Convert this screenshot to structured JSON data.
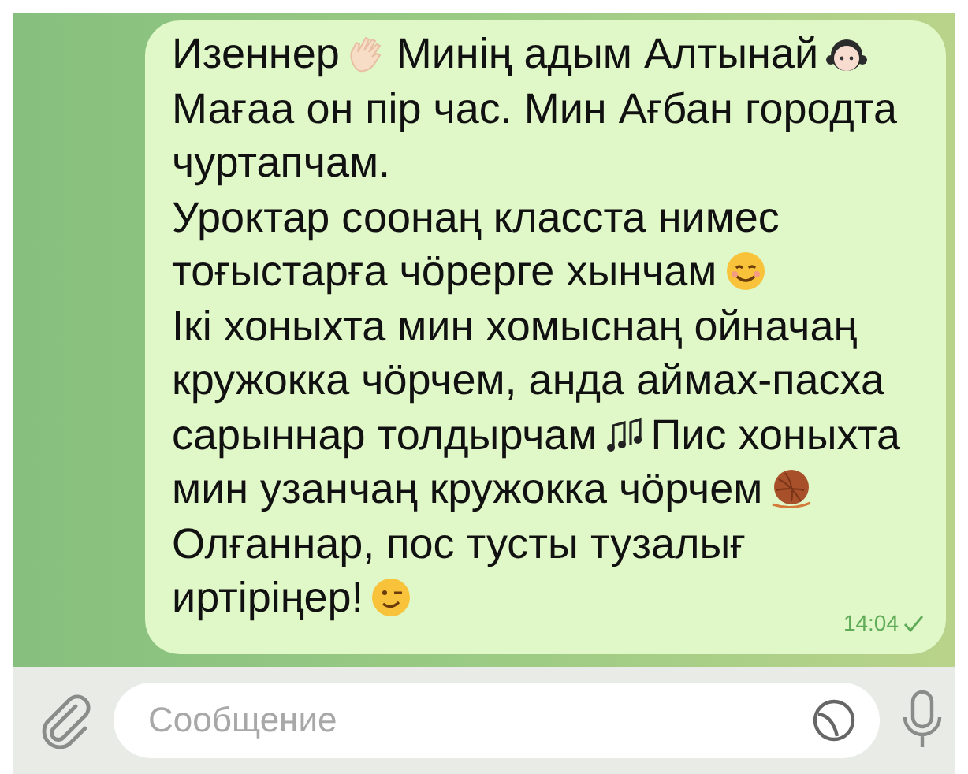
{
  "message": {
    "lines": [
      {
        "segments": [
          {
            "kind": "text",
            "text": "Изеннер"
          },
          {
            "kind": "emoji"
          },
          {
            "kind": "text",
            "text": "Минің адым Алтынай"
          },
          {
            "kind": "emoji"
          }
        ]
      },
      {
        "segments": [
          {
            "kind": "text",
            "text": "Мағаа он пір час. Мин Ағбан городта"
          }
        ]
      },
      {
        "segments": [
          {
            "kind": "text",
            "text": "чуртапчам."
          }
        ]
      },
      {
        "segments": [
          {
            "kind": "text",
            "text": "Уроктар соонаң класста нимес"
          }
        ]
      },
      {
        "segments": [
          {
            "kind": "text",
            "text": "тоғыстарға чӧрерге хынчам"
          },
          {
            "kind": "emoji"
          }
        ]
      },
      {
        "segments": [
          {
            "kind": "text",
            "text": "Ікі хоныхта мин хомыснаң ойначаң"
          }
        ]
      },
      {
        "segments": [
          {
            "kind": "text",
            "text": "кружокка чӧрчем, анда аймах-пасха"
          }
        ]
      },
      {
        "segments": [
          {
            "kind": "text",
            "text": "сарыннар толдырчам"
          },
          {
            "kind": "emoji"
          },
          {
            "kind": "text",
            "text": "Пис хоныхта"
          }
        ]
      },
      {
        "segments": [
          {
            "kind": "text",
            "text": "мин узанчаң кружокка чӧрчем"
          },
          {
            "kind": "emoji"
          }
        ]
      },
      {
        "segments": [
          {
            "kind": "text",
            "text": "Олғаннар, пос тусты тузалығ"
          }
        ]
      },
      {
        "segments": [
          {
            "kind": "text",
            "text": "иртіріңер!"
          },
          {
            "kind": "emoji"
          }
        ]
      }
    ],
    "time": "14:04"
  },
  "composer": {
    "placeholder": "Сообщение"
  }
}
